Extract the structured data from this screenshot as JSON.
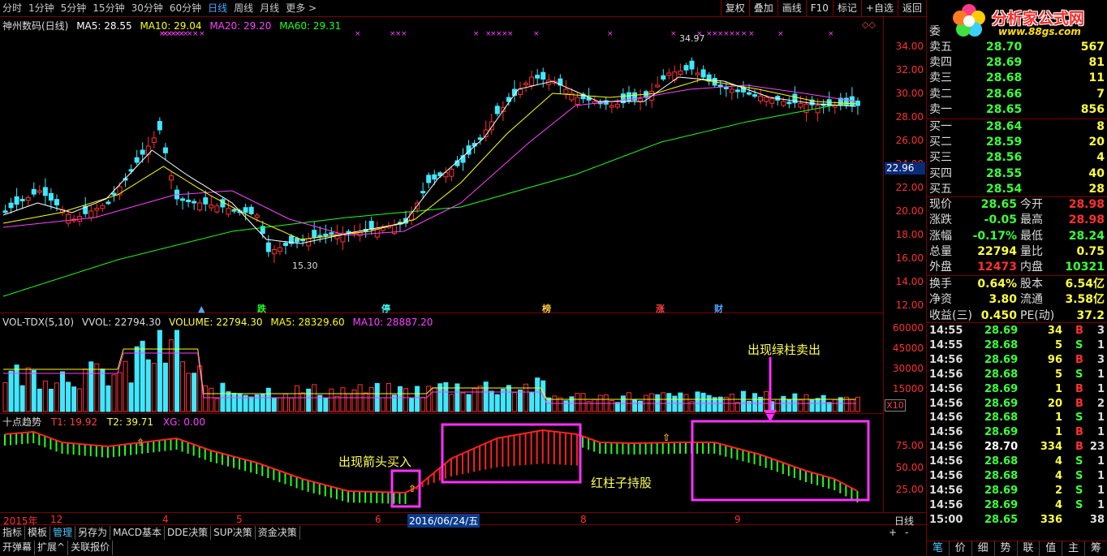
{
  "toolbar": {
    "periods": [
      "分时",
      "1分钟",
      "5分钟",
      "15分钟",
      "30分钟",
      "60分钟",
      "日线",
      "周线",
      "月线",
      "更多 >"
    ],
    "active_period": "日线",
    "buttons": [
      "复权",
      "叠加",
      "画线",
      "F10",
      "标记",
      "+自选",
      "返回"
    ]
  },
  "main_chart": {
    "title": "神州数码(日线)",
    "ma5": "MA5: 28.55",
    "ma10": "MA10: 29.04",
    "ma20": "MA20: 29.20",
    "ma60": "MA60: 29.31",
    "ma5_color": "#ffffff",
    "ma10_color": "#ffff00",
    "ma20_color": "#ff40ff",
    "ma60_color": "#20ff20",
    "y_ticks": [
      "34.00",
      "32.00",
      "30.00",
      "28.00",
      "26.00",
      "24.00",
      "22.00",
      "20.00",
      "18.00",
      "16.00",
      "14.00",
      "12.00"
    ],
    "current_price_tag": "22.96",
    "high_label": "34.97",
    "low_label": "15.30",
    "event_markers": [
      {
        "text": "跌",
        "color": "#20ff20"
      },
      {
        "text": "停",
        "color": "#40ffff"
      },
      {
        "text": "榜",
        "color": "#ffcc40"
      },
      {
        "text": "涨",
        "color": "#ff4040"
      },
      {
        "text": "财",
        "color": "#4aa8ff"
      }
    ]
  },
  "volume_chart": {
    "name": "VOL-TDX(5,10)",
    "vvol": "VVOL: 22794.30",
    "volume": "VOLUME: 22794.30",
    "ma5": "MA5: 28329.60",
    "ma10": "MA10: 28887.20",
    "y_ticks": [
      "60000",
      "45000",
      "30000",
      "15000"
    ],
    "unit": "X10"
  },
  "indicator_chart": {
    "name": "十点趋势",
    "t1": "T1: 19.92",
    "t2": "T2: 39.71",
    "xg": "XG: 0.00",
    "y_ticks": [
      "75.00",
      "50.00",
      "25.00"
    ],
    "annotation_buy": "出现箭头买入",
    "annotation_hold": "红柱子持股",
    "annotation_sell": "出现绿柱卖出"
  },
  "date_axis": {
    "labels": [
      "2015年",
      "12",
      "4",
      "5",
      "6",
      "2016/06/24/五",
      "8",
      "9"
    ],
    "period_label": "日线"
  },
  "bottom_tabs_1": [
    "指标",
    "模板",
    "管理",
    "另存为",
    "MACD基本",
    "DDE决策",
    "SUP决策",
    "资金决策"
  ],
  "bottom_tabs_1_active": "管理",
  "bottom_tabs_2": [
    "开弹幕",
    "扩展^",
    "关联报价"
  ],
  "logo": {
    "title": "分析家公式网",
    "url": "www.88gs.com"
  },
  "order_book": {
    "sell_header": "委",
    "sell": [
      {
        "label": "卖五",
        "price": "28.70",
        "vol": "567"
      },
      {
        "label": "卖四",
        "price": "28.69",
        "vol": "81"
      },
      {
        "label": "卖三",
        "price": "28.68",
        "vol": "11"
      },
      {
        "label": "卖二",
        "price": "28.66",
        "vol": "7"
      },
      {
        "label": "卖一",
        "price": "28.65",
        "vol": "856"
      }
    ],
    "buy": [
      {
        "label": "买一",
        "price": "28.64",
        "vol": "8"
      },
      {
        "label": "买二",
        "price": "28.59",
        "vol": "20"
      },
      {
        "label": "买三",
        "price": "28.56",
        "vol": "4"
      },
      {
        "label": "买四",
        "price": "28.55",
        "vol": "40"
      },
      {
        "label": "买五",
        "price": "28.54",
        "vol": "28"
      }
    ]
  },
  "stats": [
    {
      "a": "现价",
      "b": "28.65",
      "bc": "#3cff3c",
      "c": "今开",
      "d": "28.98",
      "dc": "#ff3030"
    },
    {
      "a": "涨跌",
      "b": "-0.05",
      "bc": "#3cff3c",
      "c": "最高",
      "d": "28.98",
      "dc": "#ff3030"
    },
    {
      "a": "涨幅",
      "b": "-0.17%",
      "bc": "#3cff3c",
      "c": "最低",
      "d": "28.24",
      "dc": "#3cff3c"
    },
    {
      "a": "总量",
      "b": "22794",
      "bc": "#ffff40",
      "c": "量比",
      "d": "0.75",
      "dc": "#ffff40"
    },
    {
      "a": "外盘",
      "b": "12473",
      "bc": "#ff3030",
      "c": "内盘",
      "d": "10321",
      "dc": "#3cff3c"
    },
    {
      "a": "换手",
      "b": "0.64%",
      "bc": "#ffff40",
      "c": "股本",
      "d": "6.54亿",
      "dc": "#ffff40"
    },
    {
      "a": "净资",
      "b": "3.80",
      "bc": "#ffff40",
      "c": "流通",
      "d": "3.58亿",
      "dc": "#ffff40"
    },
    {
      "a": "收益(三)",
      "b": "0.450",
      "bc": "#ffff40",
      "c": "PE(动)",
      "d": "37.2",
      "dc": "#ffff40"
    }
  ],
  "ticks": [
    {
      "t": "14:55",
      "p": "28.69",
      "v": "34",
      "bs": "B",
      "n": "3"
    },
    {
      "t": "14:55",
      "p": "28.68",
      "v": "5",
      "bs": "S",
      "n": "1"
    },
    {
      "t": "14:56",
      "p": "28.69",
      "v": "96",
      "bs": "B",
      "n": "3"
    },
    {
      "t": "14:56",
      "p": "28.68",
      "v": "5",
      "bs": "S",
      "n": "1"
    },
    {
      "t": "14:56",
      "p": "28.69",
      "v": "1",
      "bs": "B",
      "n": "1"
    },
    {
      "t": "14:56",
      "p": "28.69",
      "v": "20",
      "bs": "B",
      "n": "2"
    },
    {
      "t": "14:56",
      "p": "28.68",
      "v": "1",
      "bs": "S",
      "n": "1"
    },
    {
      "t": "14:56",
      "p": "28.69",
      "v": "1",
      "bs": "B",
      "n": "1"
    },
    {
      "t": "14:56",
      "p": "28.70",
      "v": "334",
      "bs": "B",
      "n": "23"
    },
    {
      "t": "14:56",
      "p": "28.68",
      "v": "4",
      "bs": "S",
      "n": "1"
    },
    {
      "t": "14:56",
      "p": "28.68",
      "v": "4",
      "bs": "S",
      "n": "1"
    },
    {
      "t": "14:56",
      "p": "28.69",
      "v": "2",
      "bs": "S",
      "n": "1"
    },
    {
      "t": "14:56",
      "p": "28.69",
      "v": "4",
      "bs": "S",
      "n": "1"
    },
    {
      "t": "15:00",
      "p": "28.65",
      "v": "336",
      "bs": "",
      "n": "38"
    }
  ],
  "right_tabs": [
    "笔",
    "价",
    "细",
    "势",
    "联",
    "值",
    "主",
    "筹"
  ],
  "right_tabs_active": "笔"
}
